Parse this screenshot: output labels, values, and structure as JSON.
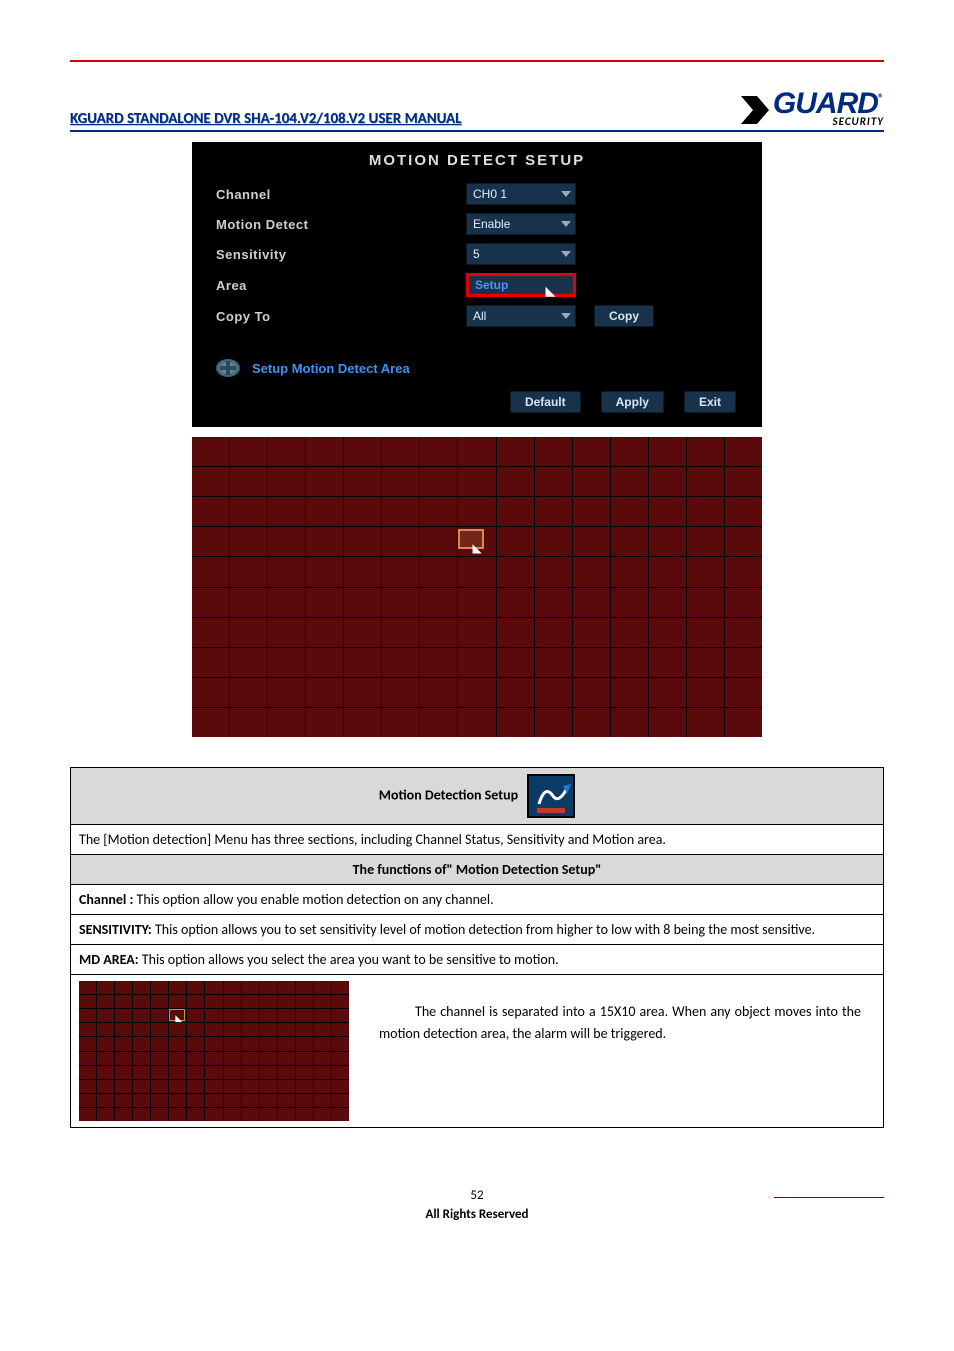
{
  "header": {
    "title": "KGUARD STANDALONE DVR SHA-104.V2/108.V2 USER MANUAL",
    "logo_main": "GUARD",
    "logo_sub": "SECURITY",
    "logo_reg": "®"
  },
  "panel": {
    "title": "MOTION  DETECT  SETUP",
    "rows": {
      "channel": {
        "label": "Channel",
        "value": "CH0 1"
      },
      "motion_detect": {
        "label": "Motion  Detect",
        "value": "Enable"
      },
      "sensitivity": {
        "label": "Sensitivity",
        "value": "5"
      },
      "area": {
        "label": "Area",
        "button": "Setup"
      },
      "copy_to": {
        "label": "Copy  To",
        "value": "All",
        "copy_btn": "Copy"
      }
    },
    "hint": "Setup  Motion  Detect  Area",
    "buttons": {
      "default": "Default",
      "apply": "Apply",
      "exit": "Exit"
    }
  },
  "info": {
    "header_label": "Motion Detection Setup",
    "intro": "The [Motion detection] Menu has three sections, including Channel Status, Sensitivity and Motion area.",
    "section_title": "The functions of\" Motion Detection Setup\"",
    "channel_label": "Channel :",
    "channel_text": " This option allow you enable motion detection on any channel.",
    "sensitivity_label": "SENSITIVITY:",
    "sensitivity_text": " This option allows you to set sensitivity level of motion detection from higher to low with 8 being the most sensitive.",
    "mdarea_label": "MD AREA:",
    "mdarea_text": " This option allows you select the area you want to be sensitive to motion.",
    "mdarea_desc": "The channel is separated into a 15X10 area. When any object moves into the motion detection area, the alarm will be triggered."
  },
  "footer": {
    "page": "52",
    "rights": "All Rights Reserved"
  }
}
